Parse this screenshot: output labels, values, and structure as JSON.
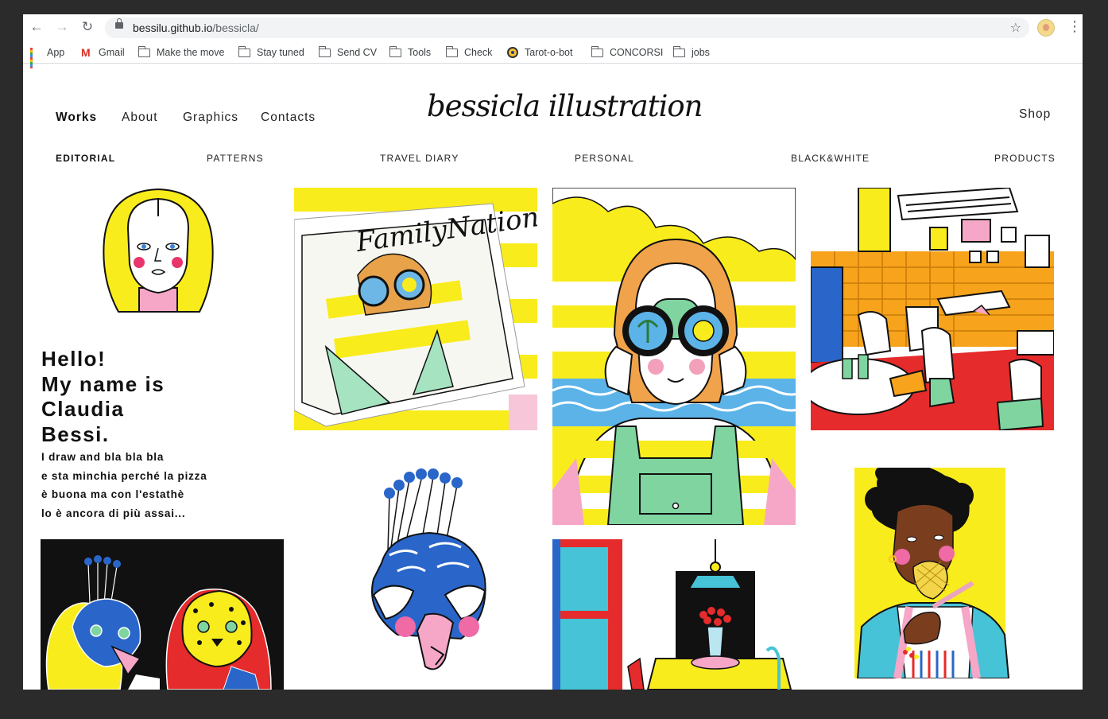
{
  "browser": {
    "url_host": "bessilu.github.io",
    "url_path": "/bessicla/",
    "bookmarks": [
      "App",
      "Gmail",
      "Make the move",
      "Stay tuned",
      "Send CV",
      "Tools",
      "Check",
      "Tarot-o-bot",
      "CONCORSI",
      "jobs"
    ]
  },
  "site": {
    "logo": "bessicla illustration",
    "nav": [
      "Works",
      "About",
      "Graphics",
      "Contacts"
    ],
    "shop": "Shop",
    "categories": [
      "EDITORIAL",
      "PATTERNS",
      "TRAVEL DIARY",
      "PERSONAL",
      "BLACK&WHITE",
      "PRODUCTS"
    ],
    "intro": {
      "title_lines": [
        "Hello!",
        "My name is",
        "Claudia",
        "Bessi."
      ],
      "body_lines": [
        "I draw and bla bla bla",
        "e sta minchia perché la pizza",
        "è buona ma con l'estathè",
        "lo è ancora di più assai..."
      ]
    }
  },
  "colors": {
    "accent_yellow": "#f9ec1c",
    "accent_blue": "#2a66c9",
    "accent_pink": "#f06aa6",
    "accent_green": "#7fd4a0",
    "accent_red": "#e52b2b"
  }
}
